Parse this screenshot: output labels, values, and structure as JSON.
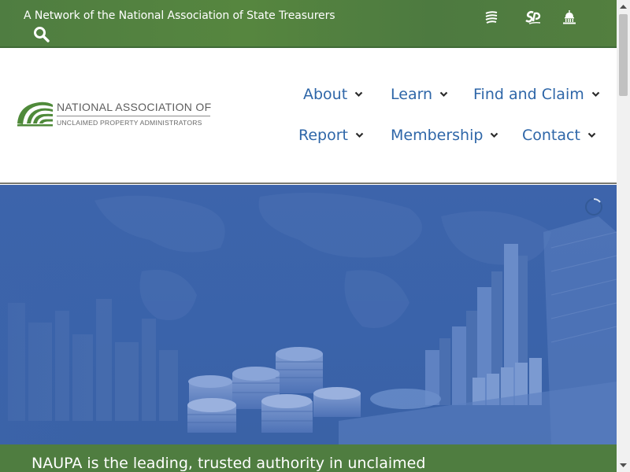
{
  "topbar": {
    "tagline": "A Network of the National Association of State Treasurers",
    "search_icon": "search-icon",
    "network_icons": [
      "nast-icon",
      "stable-icon",
      "capitol-icon"
    ]
  },
  "logo": {
    "line1": "NATIONAL ASSOCIATION OF",
    "line2": "UNCLAIMED PROPERTY ADMINISTRATORS"
  },
  "nav": {
    "items": [
      {
        "label": "About"
      },
      {
        "label": "Learn"
      },
      {
        "label": "Find and Claim"
      },
      {
        "label": "Report"
      },
      {
        "label": "Membership"
      },
      {
        "label": "Contact"
      }
    ]
  },
  "mission": {
    "text": "NAUPA is the leading, trusted authority in unclaimed"
  },
  "colors": {
    "green": "#4f7d40",
    "nav_blue": "#2e66a8",
    "hero_blue": "#3a63aa"
  }
}
